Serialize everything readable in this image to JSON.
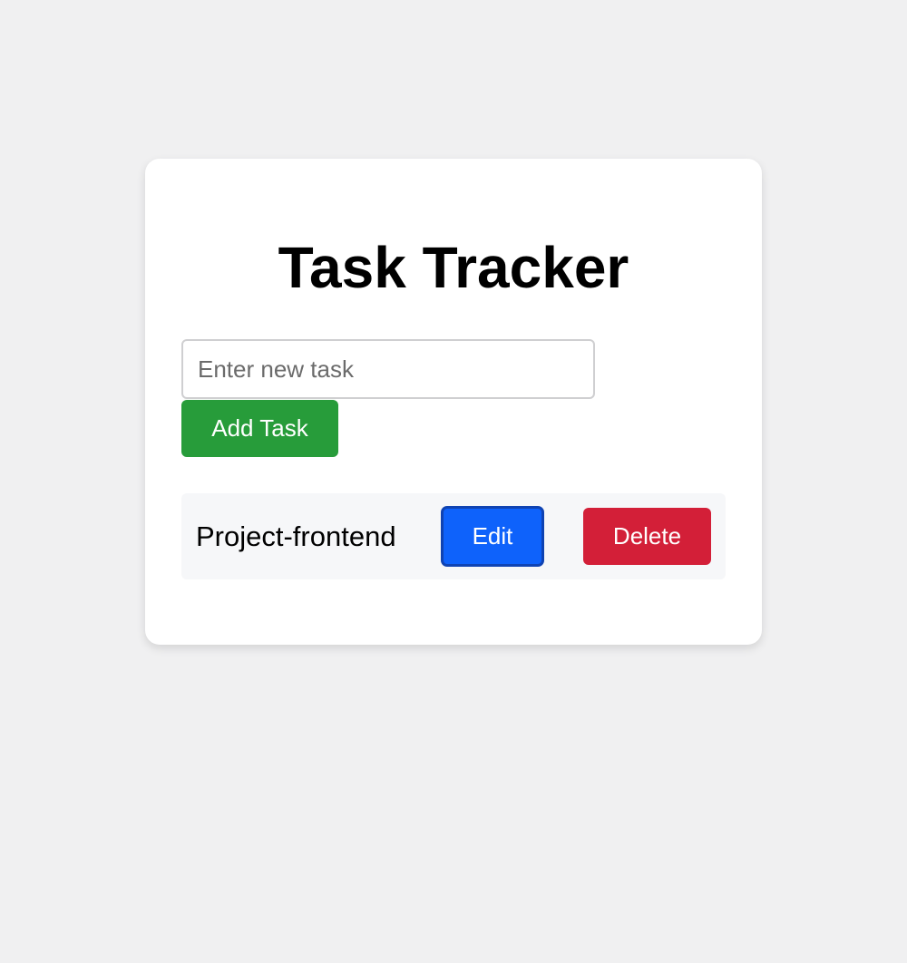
{
  "app": {
    "title": "Task Tracker"
  },
  "form": {
    "input_value": "",
    "input_placeholder": "Enter new task",
    "add_label": "Add Task"
  },
  "tasks": [
    {
      "text": "Project-frontend",
      "edit_label": "Edit",
      "delete_label": "Delete"
    }
  ],
  "colors": {
    "page_background": "#f0f0f1",
    "card_background": "#ffffff",
    "add_button": "#279c3a",
    "edit_button": "#0e62fb",
    "edit_button_border": "#0f43b3",
    "delete_button": "#d31f38",
    "task_item_background": "#f6f7f9"
  }
}
